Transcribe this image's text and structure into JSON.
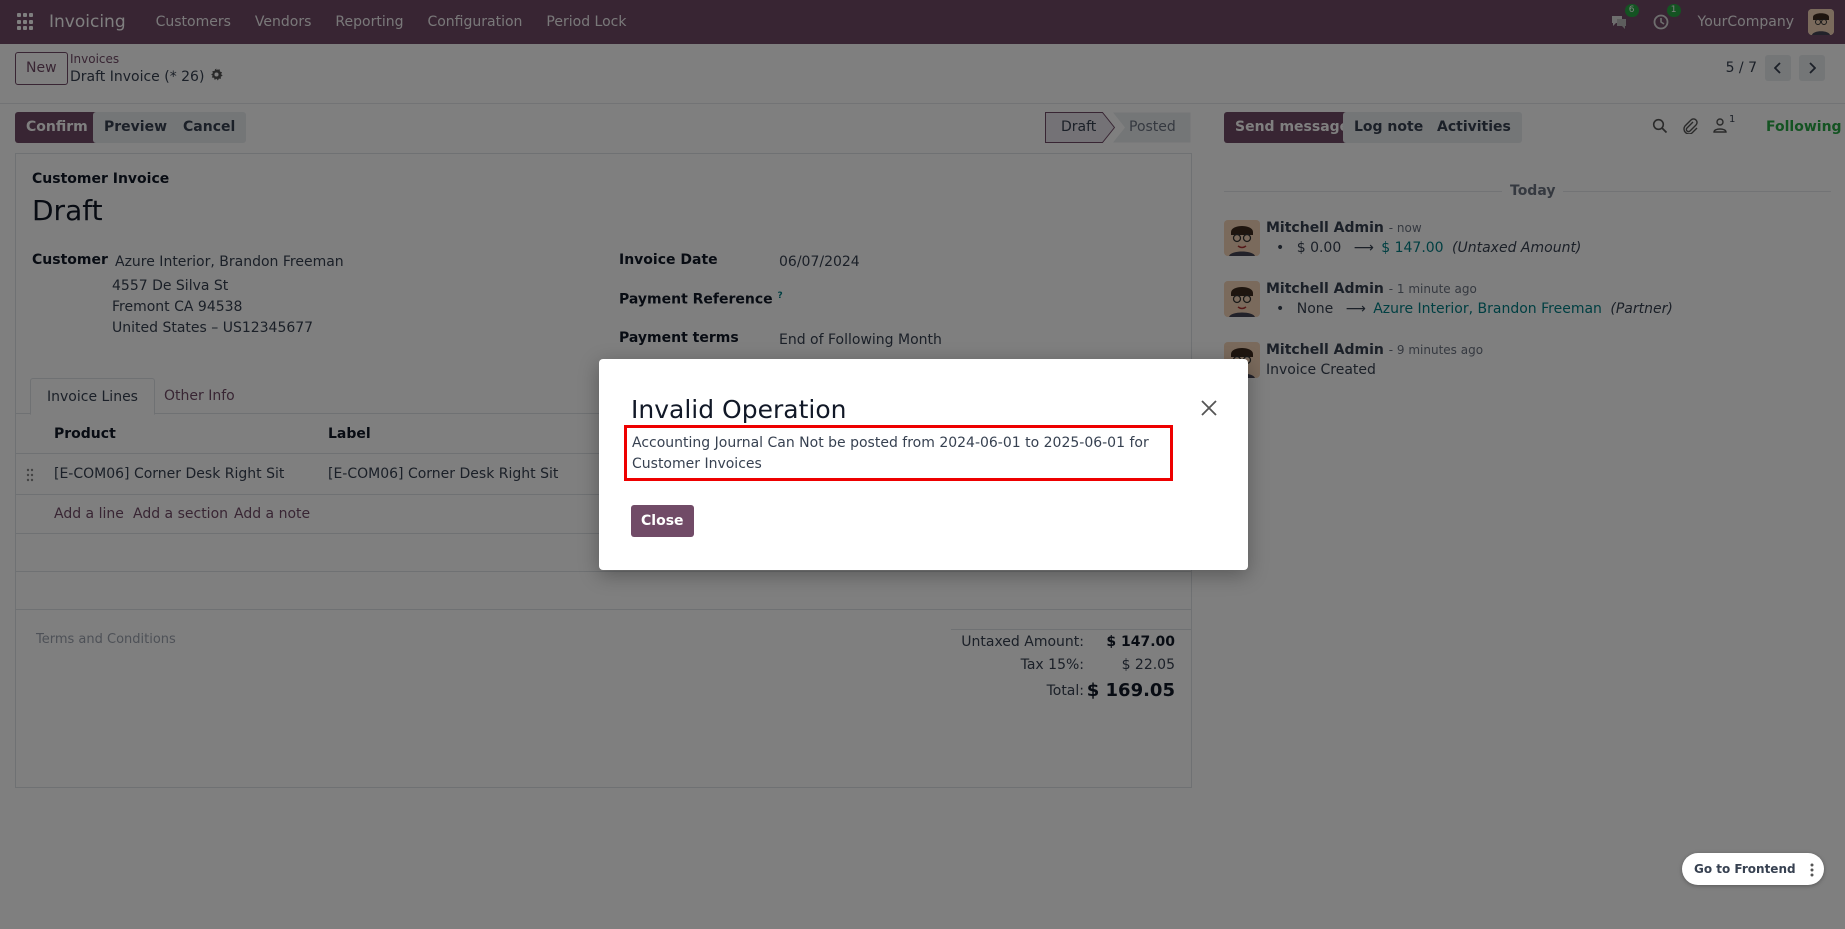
{
  "navbar": {
    "app_name": "Invoicing",
    "menu": [
      "Customers",
      "Vendors",
      "Reporting",
      "Configuration",
      "Period Lock"
    ],
    "messages_count": "6",
    "activities_count": "1",
    "company": "YourCompany"
  },
  "control_panel": {
    "new_label": "New",
    "breadcrumb_parent": "Invoices",
    "breadcrumb_current": "Draft Invoice (* 26)",
    "pager": "5 / 7"
  },
  "status_bar": {
    "confirm": "Confirm",
    "preview": "Preview",
    "cancel": "Cancel",
    "stages": [
      "Draft",
      "Posted"
    ]
  },
  "chatter_header": {
    "send_message": "Send message",
    "log_note": "Log note",
    "activities": "Activities",
    "followers_count": "1",
    "following": "Following"
  },
  "form": {
    "doc_type": "Customer Invoice",
    "title": "Draft",
    "customer_label": "Customer",
    "customer_name": "Azure Interior, Brandon Freeman",
    "address_1": "4557 De Silva St",
    "address_2": "Fremont CA 94538",
    "address_3": "United States – US12345677",
    "invoice_date_label": "Invoice Date",
    "invoice_date": "06/07/2024",
    "payment_ref_label": "Payment Reference",
    "payment_ref_help": "?",
    "payment_terms_label": "Payment terms",
    "payment_terms": "End of Following Month",
    "tabs": [
      "Invoice Lines",
      "Other Info"
    ],
    "col_product": "Product",
    "col_label": "Label",
    "line_product": "[E-COM06] Corner Desk Right Sit",
    "line_label": "[E-COM06] Corner Desk Right Sit",
    "add_line": "Add a line",
    "add_section": "Add a section",
    "add_note": "Add a note",
    "terms_placeholder": "Terms and Conditions",
    "untaxed_label": "Untaxed Amount:",
    "untaxed_value": "$ 147.00",
    "tax_label": "Tax 15%:",
    "tax_value": "$ 22.05",
    "total_label": "Total:",
    "total_value": "$ 169.05"
  },
  "chatter": {
    "date_separator": "Today",
    "messages": [
      {
        "author": "Mitchell Admin",
        "time": "- now",
        "bullet": "•",
        "old": "$ 0.00",
        "arrow": "⟶",
        "new": "$ 147.00",
        "field": "(Untaxed Amount)"
      },
      {
        "author": "Mitchell Admin",
        "time": "- 1 minute ago",
        "bullet": "•",
        "old": "None",
        "arrow": "⟶",
        "new": "Azure Interior, Brandon Freeman",
        "field": "(Partner)"
      },
      {
        "author": "Mitchell Admin",
        "time": "- 9 minutes ago",
        "body": "Invoice Created"
      }
    ]
  },
  "dialog": {
    "title": "Invalid Operation",
    "message": "Accounting Journal Can Not be posted from 2024-06-01 to 2025-06-01 for Customer Invoices",
    "close_button": "Close"
  },
  "frontend_button": "Go to Frontend",
  "colors": {
    "brand": "#714B67",
    "following": "#28a745",
    "highlight": "#e00000",
    "link": "#017e84"
  }
}
